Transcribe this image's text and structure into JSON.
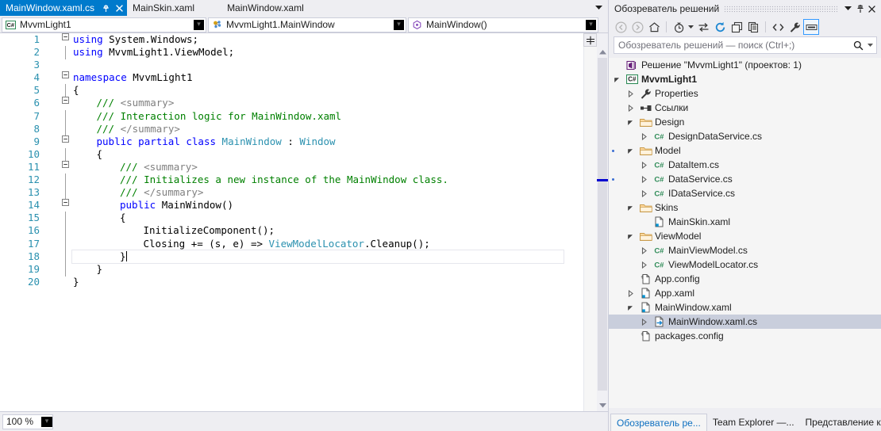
{
  "editor": {
    "tabs": [
      {
        "label": "MainWindow.xaml.cs",
        "active": true,
        "pinned": true,
        "closable": true
      },
      {
        "label": "MainSkin.xaml",
        "active": false
      },
      {
        "label": "MainWindow.xaml",
        "active": false
      }
    ],
    "navbar": {
      "project": "MvvmLight1",
      "project_icon": "csharp-icon",
      "class": "MvvmLight1.MainWindow",
      "class_icon": "class-icon",
      "member": "MainWindow()",
      "member_icon": "method-icon",
      "caret_glyph": "▾"
    },
    "lines": [
      {
        "n": "1",
        "fold": "−",
        "indent": 0,
        "spans": [
          {
            "t": "using ",
            "c": "kw"
          },
          {
            "t": "System.Windows;",
            "c": ""
          }
        ]
      },
      {
        "n": "2",
        "fold": "",
        "bar": true,
        "indent": 0,
        "spans": [
          {
            "t": "using ",
            "c": "kw"
          },
          {
            "t": "MvvmLight1.ViewModel;",
            "c": ""
          }
        ]
      },
      {
        "n": "3",
        "fold": "",
        "indent": 0,
        "spans": []
      },
      {
        "n": "4",
        "fold": "−",
        "indent": 0,
        "spans": [
          {
            "t": "namespace ",
            "c": "kw"
          },
          {
            "t": "MvvmLight1",
            "c": ""
          }
        ]
      },
      {
        "n": "5",
        "fold": "",
        "bar": true,
        "indent": 0,
        "spans": [
          {
            "t": "{",
            "c": ""
          }
        ]
      },
      {
        "n": "6",
        "fold": "−",
        "indent": 1,
        "spans": [
          {
            "t": "/// ",
            "c": "cmt"
          },
          {
            "t": "<summary>",
            "c": "xmldoc"
          }
        ]
      },
      {
        "n": "7",
        "fold": "",
        "bar": true,
        "indent": 1,
        "spans": [
          {
            "t": "/// Interaction logic for MainWindow.xaml",
            "c": "cmt"
          }
        ]
      },
      {
        "n": "8",
        "fold": "",
        "bar": true,
        "indent": 1,
        "spans": [
          {
            "t": "/// ",
            "c": "cmt"
          },
          {
            "t": "</summary>",
            "c": "xmldoc"
          }
        ]
      },
      {
        "n": "9",
        "fold": "−",
        "indent": 1,
        "spans": [
          {
            "t": "public partial class ",
            "c": "kw"
          },
          {
            "t": "MainWindow",
            "c": "cls"
          },
          {
            "t": " : ",
            "c": ""
          },
          {
            "t": "Window",
            "c": "cls"
          }
        ]
      },
      {
        "n": "10",
        "fold": "",
        "bar": true,
        "indent": 1,
        "spans": [
          {
            "t": "{",
            "c": ""
          }
        ]
      },
      {
        "n": "11",
        "fold": "−",
        "indent": 2,
        "spans": [
          {
            "t": "/// ",
            "c": "cmt"
          },
          {
            "t": "<summary>",
            "c": "xmldoc"
          }
        ]
      },
      {
        "n": "12",
        "fold": "",
        "bar": true,
        "indent": 2,
        "spans": [
          {
            "t": "/// Initializes a new instance of the MainWindow class.",
            "c": "cmt"
          }
        ]
      },
      {
        "n": "13",
        "fold": "",
        "bar": true,
        "indent": 2,
        "spans": [
          {
            "t": "/// ",
            "c": "cmt"
          },
          {
            "t": "</summary>",
            "c": "xmldoc"
          }
        ]
      },
      {
        "n": "14",
        "fold": "−",
        "indent": 2,
        "spans": [
          {
            "t": "public ",
            "c": "kw"
          },
          {
            "t": "MainWindow()",
            "c": ""
          }
        ]
      },
      {
        "n": "15",
        "fold": "",
        "bar": true,
        "indent": 2,
        "spans": [
          {
            "t": "{",
            "c": ""
          }
        ]
      },
      {
        "n": "16",
        "fold": "",
        "bar": true,
        "indent": 3,
        "spans": [
          {
            "t": "InitializeComponent();",
            "c": ""
          }
        ]
      },
      {
        "n": "17",
        "fold": "",
        "bar": true,
        "indent": 3,
        "spans": [
          {
            "t": "Closing += (s, e) => ",
            "c": ""
          },
          {
            "t": "ViewModelLocator",
            "c": "cls"
          },
          {
            "t": ".Cleanup();",
            "c": ""
          }
        ]
      },
      {
        "n": "18",
        "fold": "",
        "bar": true,
        "indent": 2,
        "current": true,
        "spans": [
          {
            "t": "}",
            "c": ""
          }
        ]
      },
      {
        "n": "19",
        "fold": "",
        "bar": true,
        "indent": 1,
        "spans": [
          {
            "t": "}",
            "c": ""
          }
        ]
      },
      {
        "n": "20",
        "fold": "",
        "indent": 0,
        "spans": [
          {
            "t": "}",
            "c": ""
          }
        ]
      }
    ],
    "statusbar": {
      "zoom": "100 %",
      "zoom_caret": "▾"
    },
    "scrollbar": {
      "up_glyph": "▲",
      "down_glyph": "▼",
      "split_icon": "split-view-icon"
    }
  },
  "solution_explorer": {
    "title": "Обозреватель решений",
    "title_buttons": [
      {
        "name": "window-dropdown-icon",
        "glyph": "▾"
      },
      {
        "name": "pin-icon",
        "glyph": "⚲"
      },
      {
        "name": "close-icon",
        "glyph": "✕"
      }
    ],
    "toolbar": [
      {
        "name": "back-icon",
        "state": "disabled"
      },
      {
        "name": "forward-icon",
        "state": "disabled"
      },
      {
        "name": "home-icon",
        "state": "normal"
      },
      {
        "name": "pending-changes-filter-icon",
        "state": "normal",
        "has_caret": true
      },
      {
        "name": "sync-with-active-document-icon",
        "state": "normal"
      },
      {
        "name": "refresh-icon",
        "state": "blue"
      },
      {
        "name": "collapse-all-icon",
        "state": "normal"
      },
      {
        "name": "show-all-files-icon",
        "state": "normal"
      },
      {
        "name": "view-code-icon",
        "state": "normal"
      },
      {
        "name": "properties-wrench-icon",
        "state": "normal"
      },
      {
        "name": "preview-selected-items-icon",
        "state": "selected"
      }
    ],
    "search": {
      "placeholder": "Обозреватель решений — поиск (Ctrl+;)",
      "icon": "search-icon",
      "caret": "▾"
    },
    "tree": [
      {
        "label": "Решение \"MvvmLight1\"  (проектов: 1)",
        "depth": 0,
        "expander": "",
        "icon": "solution-icon",
        "bold": false
      },
      {
        "label": "MvvmLight1",
        "depth": 0,
        "expander": "▲",
        "icon": "csharp-project-icon",
        "bold": true
      },
      {
        "label": "Properties",
        "depth": 1,
        "expander": "▷",
        "icon": "wrench-icon",
        "bold": false
      },
      {
        "label": "Ссылки",
        "depth": 1,
        "expander": "▷",
        "icon": "references-icon",
        "bold": false
      },
      {
        "label": "Design",
        "depth": 1,
        "expander": "▲",
        "icon": "folder-icon",
        "bold": false
      },
      {
        "label": "DesignDataService.cs",
        "depth": 2,
        "expander": "▷",
        "icon": "csharp-file-icon",
        "bold": false
      },
      {
        "label": "Model",
        "depth": 1,
        "expander": "▲",
        "icon": "folder-icon",
        "bold": false,
        "mark": true
      },
      {
        "label": "DataItem.cs",
        "depth": 2,
        "expander": "▷",
        "icon": "csharp-file-icon",
        "bold": false
      },
      {
        "label": "DataService.cs",
        "depth": 2,
        "expander": "▷",
        "icon": "csharp-file-icon",
        "bold": false,
        "mark": true
      },
      {
        "label": "IDataService.cs",
        "depth": 2,
        "expander": "▷",
        "icon": "csharp-file-icon",
        "bold": false
      },
      {
        "label": "Skins",
        "depth": 1,
        "expander": "▲",
        "icon": "folder-icon",
        "bold": false
      },
      {
        "label": "MainSkin.xaml",
        "depth": 2,
        "expander": "",
        "icon": "xaml-file-icon",
        "bold": false
      },
      {
        "label": "ViewModel",
        "depth": 1,
        "expander": "▲",
        "icon": "folder-icon",
        "bold": false
      },
      {
        "label": "MainViewModel.cs",
        "depth": 2,
        "expander": "▷",
        "icon": "csharp-file-icon",
        "bold": false
      },
      {
        "label": "ViewModelLocator.cs",
        "depth": 2,
        "expander": "▷",
        "icon": "csharp-file-icon",
        "bold": false
      },
      {
        "label": "App.config",
        "depth": 1,
        "expander": "",
        "icon": "config-file-icon",
        "bold": false
      },
      {
        "label": "App.xaml",
        "depth": 1,
        "expander": "▷",
        "icon": "xaml-file-icon",
        "bold": false
      },
      {
        "label": "MainWindow.xaml",
        "depth": 1,
        "expander": "▲",
        "icon": "xaml-file-icon",
        "bold": false
      },
      {
        "label": "MainWindow.xaml.cs",
        "depth": 2,
        "expander": "▷",
        "icon": "code-behind-icon",
        "bold": false,
        "selected": true
      },
      {
        "label": "packages.config",
        "depth": 1,
        "expander": "",
        "icon": "config-file-icon",
        "bold": false
      }
    ],
    "bottom_tabs": [
      {
        "label": "Обозреватель ре...",
        "active": true
      },
      {
        "label": "Team Explorer —...",
        "active": false
      },
      {
        "label": "Представление к...",
        "active": false
      }
    ]
  },
  "colors": {
    "accent_blue": "#007acc",
    "selection_gray": "#c9cedc",
    "keyword": "#0000ff",
    "comment": "#008000",
    "type": "#2b91af",
    "linenumber": "#2b91af",
    "chrome": "#eeeef2"
  }
}
